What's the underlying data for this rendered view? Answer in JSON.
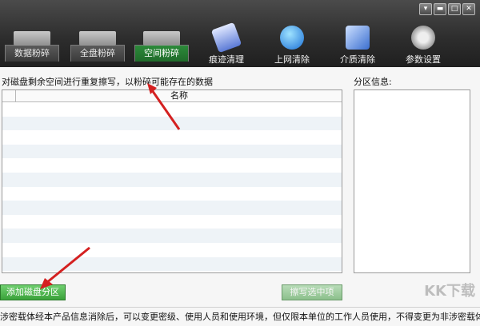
{
  "window": {
    "min": "▾",
    "restore": "▬",
    "max": "□",
    "close": "✕"
  },
  "tabs": [
    {
      "label": "数据粉碎"
    },
    {
      "label": "全盘粉碎"
    },
    {
      "label": "空间粉碎",
      "active": true
    }
  ],
  "tools": [
    {
      "label": "痕迹清理",
      "icon": "eraser-icon"
    },
    {
      "label": "上网清除",
      "icon": "globe-icon"
    },
    {
      "label": "介质清除",
      "icon": "broom-icon"
    },
    {
      "label": "参数设置",
      "icon": "gear-icon"
    }
  ],
  "main": {
    "description": "对磁盘剩余空间进行重复擦写，以粉碎可能存在的数据",
    "list_header_name": "名称",
    "partition_label": "分区信息:"
  },
  "buttons": {
    "add_partition": "添加磁盘分区",
    "wipe_selected": "擦写选中项"
  },
  "status": "涉密载体经本产品信息消除后，可以变更密级、使用人员和使用环境，但仅限本单位的工作人员使用，不得变更为非涉密载体使用。",
  "watermark": "KK下载",
  "colors": {
    "active_tab": "#1f6b2a",
    "accent": "#3aa23a",
    "arrow": "#d42020"
  }
}
